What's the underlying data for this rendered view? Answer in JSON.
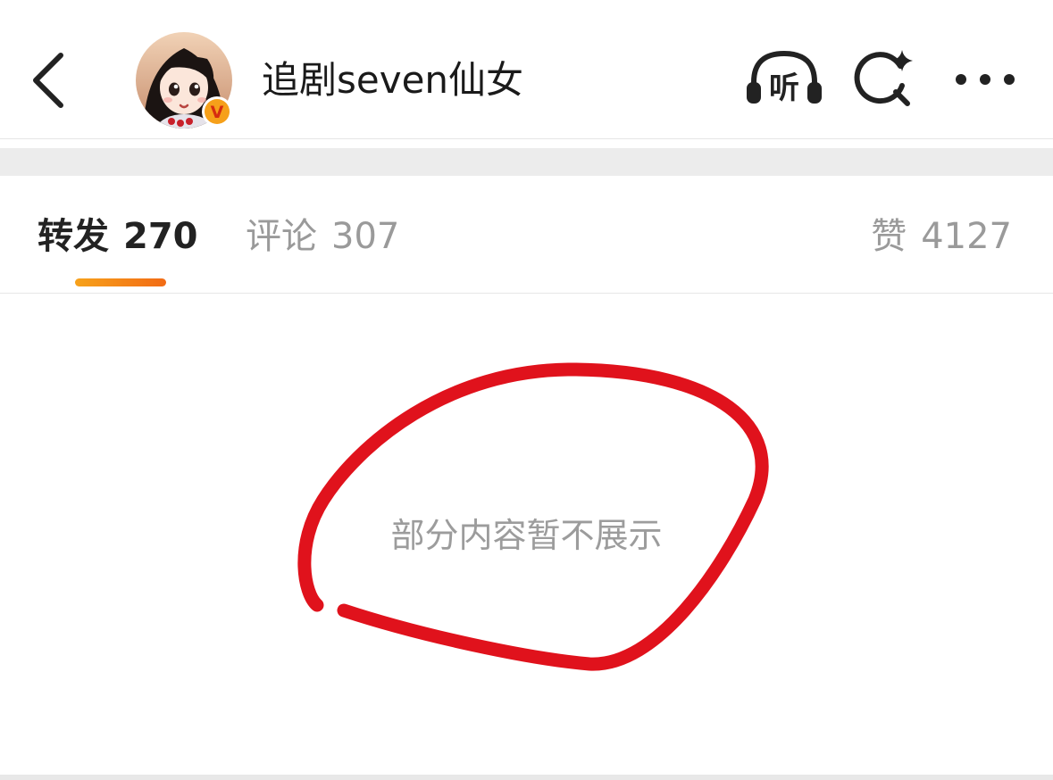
{
  "header": {
    "username": "追剧seven仙女",
    "listen_label": "听",
    "verified_badge_letter": "V",
    "avatar_alt": "",
    "accent_badge_color": "#f6a01a"
  },
  "tabs": [
    {
      "label": "转发",
      "count": "270",
      "active": true
    },
    {
      "label": "评论",
      "count": "307",
      "active": false
    }
  ],
  "like_tab": {
    "label": "赞",
    "count": "4127"
  },
  "content": {
    "notice": "部分内容暂不展示"
  },
  "colors": {
    "active_indicator": "#f58a17",
    "annotation_circle": "#e0121c"
  },
  "icons": [
    "back-chevron-icon",
    "listen-headphones-icon",
    "search-sparkle-icon",
    "more-dots-icon"
  ]
}
